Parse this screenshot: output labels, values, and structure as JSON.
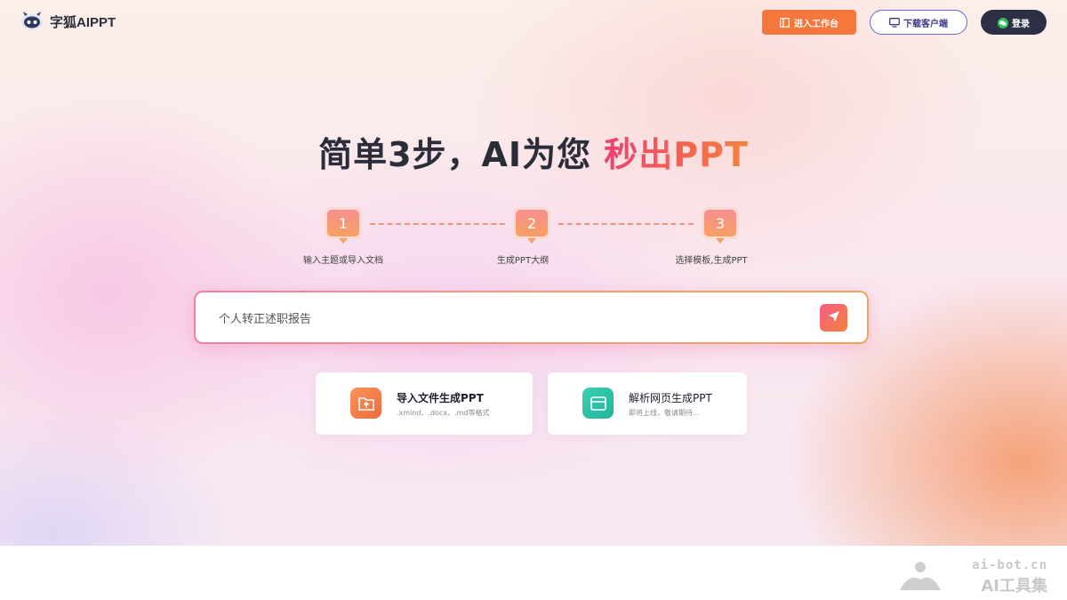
{
  "header": {
    "logo_text": "字狐AIPPT",
    "workspace_button": "进入工作台",
    "download_button": "下载客户端",
    "login_button": "登录"
  },
  "hero": {
    "title_main": "简单3步，AI为您 ",
    "title_highlight": "秒出PPT"
  },
  "steps": [
    {
      "number": "1",
      "label": "输入主题或导入文档"
    },
    {
      "number": "2",
      "label": "生成PPT大纲"
    },
    {
      "number": "3",
      "label": "选择模板,生成PPT"
    }
  ],
  "search": {
    "value": "个人转正述职报告"
  },
  "cards": [
    {
      "title": "导入文件生成PPT",
      "subtitle": ".xmind、.docx、.md等格式",
      "icon": "upload-file-icon"
    },
    {
      "title": "解析网页生成PPT",
      "subtitle": "即将上线，敬请期待...",
      "icon": "webpage-icon"
    }
  ],
  "watermark": {
    "url": "ai-bot.cn",
    "name": "AI工具集"
  },
  "colors": {
    "accent_orange": "#f5773c",
    "accent_purple": "#6a62d6",
    "dark": "#2d3045",
    "highlight_start": "#ef3f72",
    "highlight_end": "#f5823a",
    "teal": "#2cc4a5"
  }
}
